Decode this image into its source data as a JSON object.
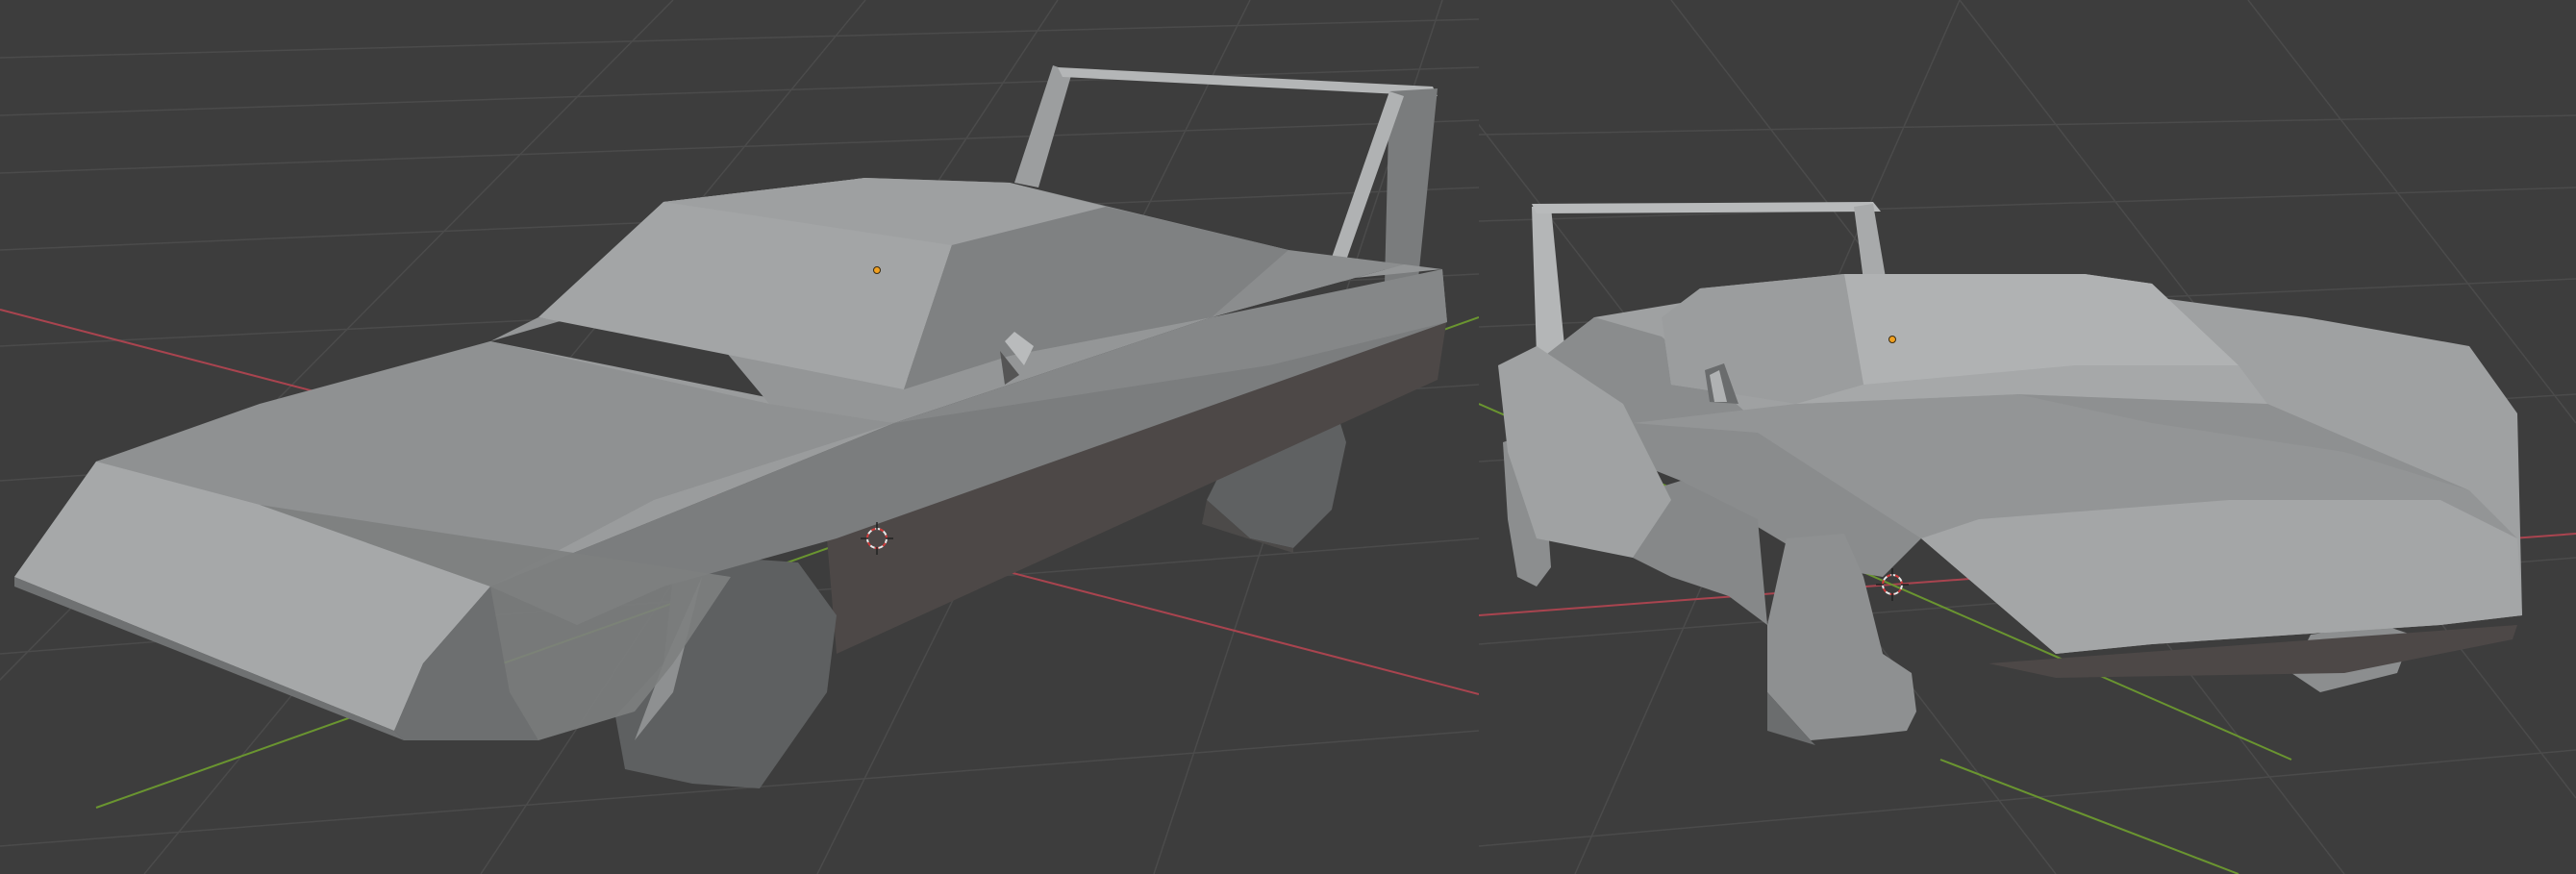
{
  "app": "3D viewport",
  "colors": {
    "viewport_bg": "#3d3d3d",
    "grid_line": "#4a4a4a",
    "x_axis": "#b34a55",
    "y_axis": "#6e9a2e",
    "mesh_light": "#a8aaab",
    "mesh_mid": "#8c8e8f",
    "mesh_dark": "#6a6c6d",
    "mesh_shadow": "#4a4645",
    "origin_dot": "#f0a020",
    "cursor_red": "#d23c3c"
  },
  "viewports": [
    {
      "name": "left-viewport",
      "object": "car-mesh",
      "icons": [
        "object-origin-icon",
        "3d-cursor-icon"
      ]
    },
    {
      "name": "right-viewport",
      "object": "car-mesh",
      "icons": [
        "object-origin-icon",
        "3d-cursor-icon"
      ]
    }
  ]
}
